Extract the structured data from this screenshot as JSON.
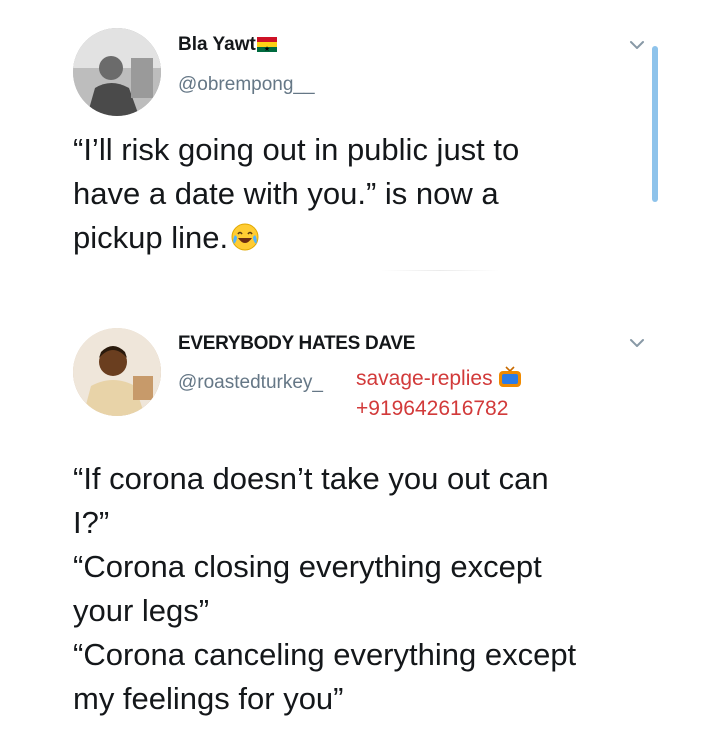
{
  "tweets": [
    {
      "author_name": "Bla Yawt",
      "name_suffix_icon": "ghana-flag-icon",
      "handle": "@obrempong__",
      "text_lines": [
        "“I’ll risk going out in public just to",
        "have a date with you.” is now a",
        "pickup line."
      ],
      "text_emoji": "tears-of-joy-emoji",
      "menu_icon": "chevron-down-icon"
    },
    {
      "author_name": "EVERYBODY HATES DAVE",
      "handle": "@roastedturkey_",
      "text_lines": [
        "“If corona doesn’t take you out can",
        "I?”",
        "“Corona closing everything except",
        "your legs”",
        "“Corona canceling everything except",
        "my feelings for you”"
      ],
      "menu_icon": "chevron-down-icon"
    }
  ],
  "watermark": {
    "label": "savage-replies",
    "phone": "+919642616782",
    "icon": "tv-icon",
    "color": "#d23a3a"
  },
  "colors": {
    "text": "#14171a",
    "handle": "#657786",
    "scrollbar": "#8ec3eb"
  }
}
